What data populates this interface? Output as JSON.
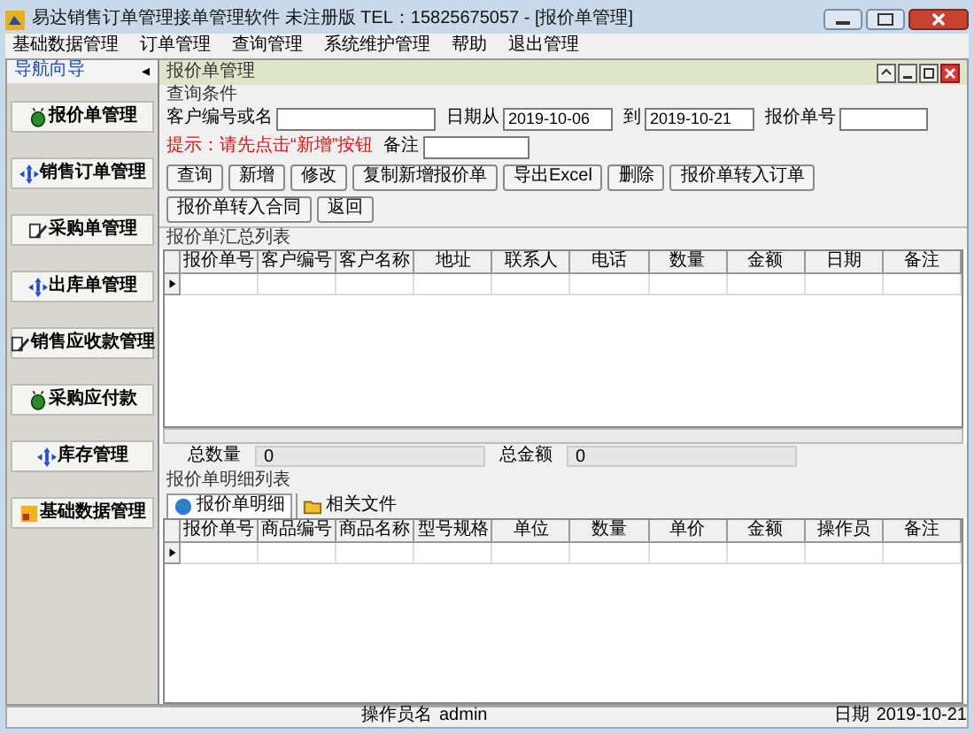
{
  "window": {
    "title": "易达销售订单管理接单管理软件 未注册版 TEL：15825675057 - [报价单管理]"
  },
  "menu": [
    "基础数据管理",
    "订单管理",
    "查询管理",
    "系统维护管理",
    "帮助",
    "退出管理"
  ],
  "nav": {
    "title": "导航向导",
    "collapse_glyph": "◂",
    "items": [
      {
        "label": "报价单管理",
        "kind": "beetle"
      },
      {
        "label": "销售订单管理",
        "kind": "arrows"
      },
      {
        "label": "采购单管理",
        "kind": "pen"
      },
      {
        "label": "出库单管理",
        "kind": "arrows"
      },
      {
        "label": "销售应收款管理",
        "kind": "pen"
      },
      {
        "label": "采购应付款",
        "kind": "beetle"
      },
      {
        "label": "库存管理",
        "kind": "arrows"
      },
      {
        "label": "基础数据管理",
        "kind": "blocks"
      }
    ]
  },
  "child_window": {
    "title": "报价单管理"
  },
  "query": {
    "title": "查询条件",
    "fields": [
      {
        "label": "客户编号或名"
      },
      {
        "label": "日期从",
        "value": "2019-10-06"
      },
      {
        "label": "到",
        "value": "2019-10-21"
      },
      {
        "label": "报价单号"
      },
      {
        "label": "备注"
      }
    ],
    "hint": "提示：请先点击“新增”按钮",
    "buttons": [
      "查询",
      "新增",
      "修改",
      "复制新增报价单",
      "导出Excel",
      "删除",
      "报价单转入订单",
      "报价单转入合同",
      "返回"
    ]
  },
  "summary": {
    "title": "报价单汇总列表",
    "columns": [
      "报价单号",
      "客户编号",
      "客户名称",
      "地址",
      "联系人",
      "电话",
      "数量",
      "金额",
      "日期",
      "备注"
    ]
  },
  "totals": [
    {
      "label": "总数量",
      "value": "0"
    },
    {
      "label": "总金额",
      "value": "0"
    }
  ],
  "detail": {
    "title": "报价单明细列表",
    "tabs": [
      {
        "label": "报价单明细",
        "selected": true,
        "kind": "globe"
      },
      {
        "label": "相关文件",
        "selected": false,
        "kind": "folder"
      }
    ],
    "columns": [
      "报价单号",
      "商品编号",
      "商品名称",
      "型号规格",
      "单位",
      "数量",
      "单价",
      "金额",
      "操作员",
      "备注"
    ]
  },
  "status_bar": [
    {
      "label": "操作员名",
      "value": "admin"
    },
    {
      "label": "日期",
      "value": "2019-10-21"
    }
  ]
}
